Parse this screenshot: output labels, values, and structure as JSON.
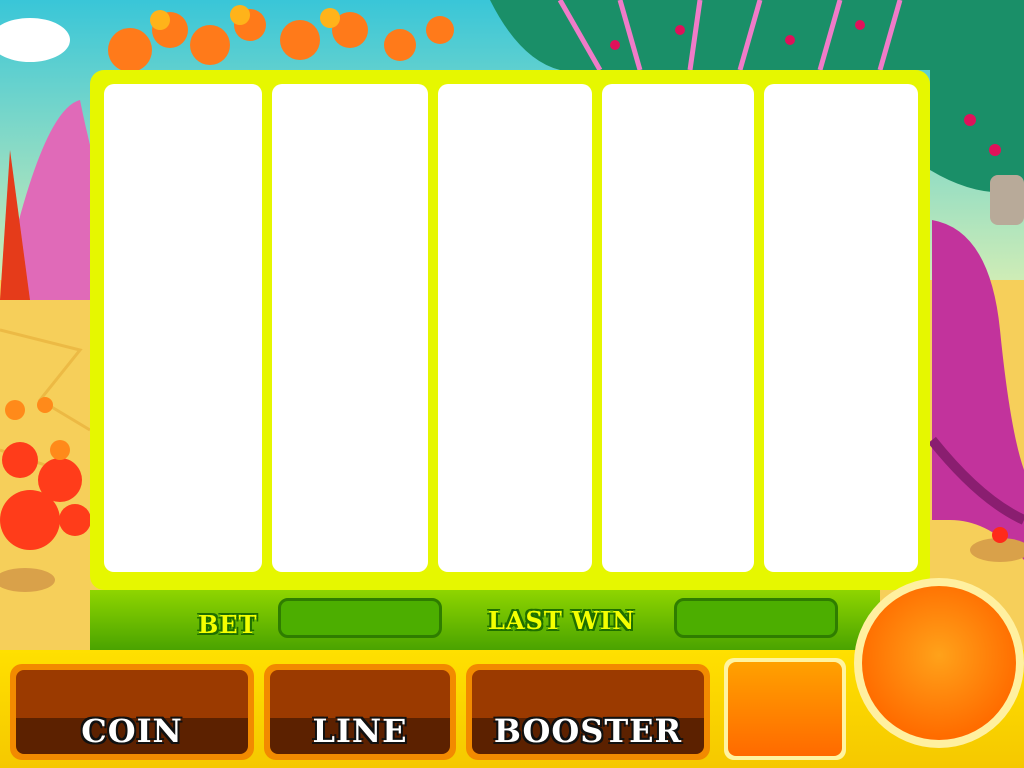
{
  "info_bar": {
    "bet_label": "BET",
    "bet_value": "",
    "last_win_label": "LAST WIN",
    "last_win_value": ""
  },
  "controls": {
    "coin_label": "COIN",
    "line_label": "LINE",
    "booster_label": "BOOSTER"
  },
  "colors": {
    "reel_frame": "#e6f700",
    "info_bar": "#4aa300",
    "label_text": "#f4ff00",
    "button_dark": "#5c2100",
    "spin_button": "#ff6d00"
  }
}
